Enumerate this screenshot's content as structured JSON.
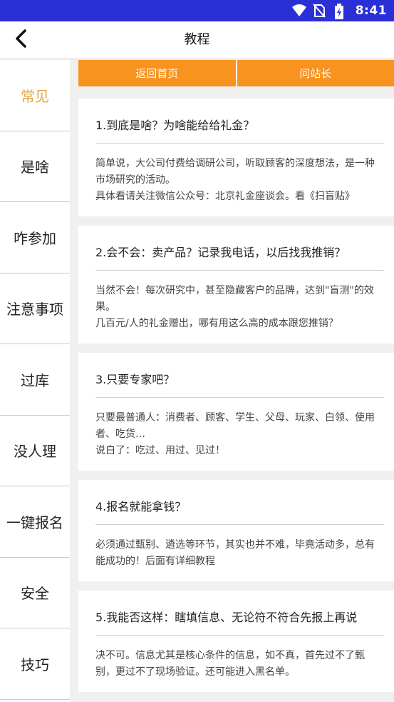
{
  "status_bar": {
    "time": "8:41",
    "icons": [
      "wifi-icon",
      "no-sim-icon",
      "battery-charging-icon"
    ],
    "background": "#2b2fd6"
  },
  "header": {
    "title": "教程",
    "back_icon": "chevron-left-icon"
  },
  "sidebar": {
    "items": [
      {
        "label": "常见",
        "active": true
      },
      {
        "label": "是啥",
        "active": false
      },
      {
        "label": "咋参加",
        "active": false
      },
      {
        "label": "注意事项",
        "active": false
      },
      {
        "label": "过库",
        "active": false
      },
      {
        "label": "没人理",
        "active": false
      },
      {
        "label": "一键报名",
        "active": false
      },
      {
        "label": "安全",
        "active": false
      },
      {
        "label": "技巧",
        "active": false
      }
    ],
    "active_color": "#e0a63a"
  },
  "tabs": {
    "home": "返回首页",
    "ask": "问站长",
    "color": "#f7931e"
  },
  "faq": [
    {
      "question": "1.到底是啥？为啥能给给礼金？",
      "answer": "简单说，大公司付费给调研公司，听取顾客的深度想法，是一种市场研究的活动。\n具体看请关注微信公众号：北京礼金座谈会。看《扫盲贴》"
    },
    {
      "question": "2.会不会：卖产品？记录我电话，以后找我推销？",
      "answer": "当然不会！每次研究中，甚至隐藏客户的品牌，达到\"盲测\"的效果。\n几百元/人的礼金赠出，哪有用这么高的成本跟您推销？"
    },
    {
      "question": "3.只要专家吧？",
      "answer": "只要最普通人：消费者、顾客、学生、父母、玩家、白领、使用者、吃货…\n说白了：吃过、用过、见过！"
    },
    {
      "question": "4.报名就能拿钱？",
      "answer": "必须通过甄别、遴选等环节，其实也并不难，毕竟活动多，总有能成功的！后面有详细教程"
    },
    {
      "question": "5.我能否这样：瞎填信息、无论符不符合先报上再说",
      "answer": "决不可。信息尤其是核心条件的信息，如不真，首先过不了甄别，更过不了现场验证。还可能进入黑名单。"
    }
  ]
}
